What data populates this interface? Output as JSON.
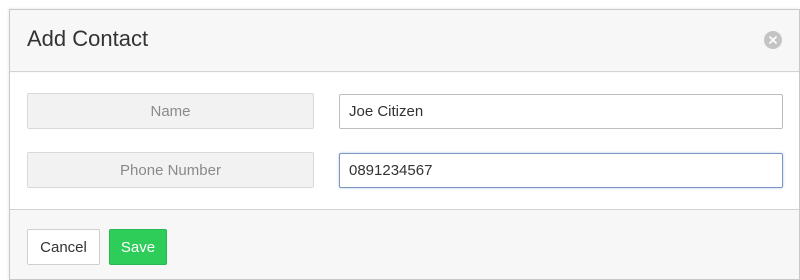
{
  "dialog": {
    "title": "Add Contact",
    "close_icon": "close-circle-icon"
  },
  "form": {
    "fields": [
      {
        "label": "Name",
        "value": "Joe Citizen",
        "focused": false
      },
      {
        "label": "Phone Number",
        "value": "0891234567",
        "focused": true
      }
    ]
  },
  "footer": {
    "cancel_label": "Cancel",
    "save_label": "Save"
  },
  "colors": {
    "save_button": "#2ecc59",
    "focus_border": "#7d97c4"
  }
}
